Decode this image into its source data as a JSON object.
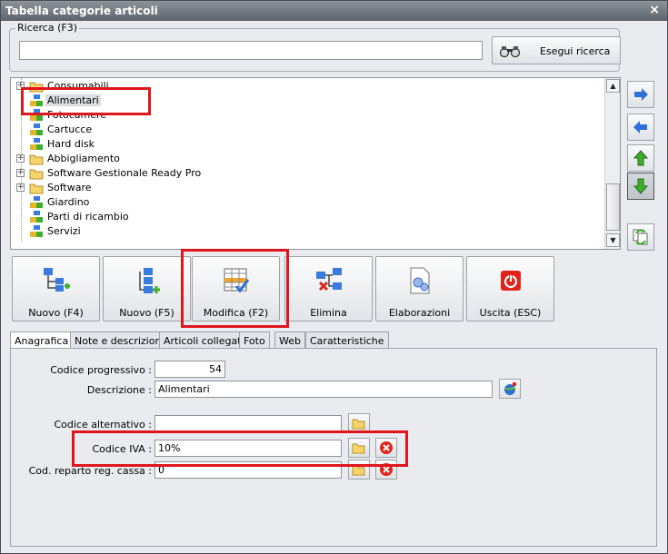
{
  "window": {
    "title": "Tabella categorie articoli",
    "close_symbol": "×"
  },
  "search": {
    "group_label": "Ricerca (F3)",
    "input_value": "",
    "button_label": "Esegui ricerca",
    "button_icon": "binoculars-icon"
  },
  "tree": {
    "items": [
      {
        "label": "Consumabili",
        "icon": "folder-icon",
        "expandable": true
      },
      {
        "label": "Alimentari",
        "icon": "category-icon",
        "expandable": false,
        "selected": true
      },
      {
        "label": "Fotocamere",
        "icon": "category-icon",
        "expandable": false
      },
      {
        "label": "Cartucce",
        "icon": "category-icon",
        "expandable": false
      },
      {
        "label": "Hard disk",
        "icon": "category-icon",
        "expandable": false
      },
      {
        "label": "Abbigliamento",
        "icon": "folder-icon",
        "expandable": true
      },
      {
        "label": "Software Gestionale Ready Pro",
        "icon": "folder-icon",
        "expandable": true
      },
      {
        "label": "Software",
        "icon": "folder-icon",
        "expandable": true
      },
      {
        "label": "Giardino",
        "icon": "category-icon",
        "expandable": false
      },
      {
        "label": "Parti di ricambio",
        "icon": "category-icon",
        "expandable": false
      },
      {
        "label": "Servizi",
        "icon": "category-icon",
        "expandable": false
      }
    ]
  },
  "side_buttons": [
    "arrow-right-icon",
    "arrow-left-icon",
    "arrow-up-icon",
    "arrow-down-icon",
    "refresh-icon"
  ],
  "toolbar": {
    "nuovo_f4": "Nuovo (F4)",
    "nuovo_f5": "Nuovo (F5)",
    "modifica": "Modifica (F2)",
    "elimina": "Elimina",
    "elaborazioni": "Elaborazioni",
    "uscita": "Uscita (ESC)"
  },
  "tabs": [
    "Anagrafica",
    "Note e descrizioni",
    "Articoli collegati",
    "Foto",
    "Web",
    "Caratteristiche"
  ],
  "form": {
    "codice_progressivo_label": "Codice progressivo :",
    "codice_progressivo_value": "54",
    "descrizione_label": "Descrizione :",
    "descrizione_value": "Alimentari",
    "codice_alternativo_label": "Codice alternativo :",
    "codice_alternativo_value": "",
    "codice_iva_label": "Codice IVA :",
    "codice_iva_value": "10%",
    "cod_reparto_label": "Cod. reparto reg. cassa :",
    "cod_reparto_value": "0"
  },
  "colors": {
    "highlight": "#e0161d",
    "accent_green": "#3fae2b",
    "accent_blue": "#2e6fd8"
  }
}
